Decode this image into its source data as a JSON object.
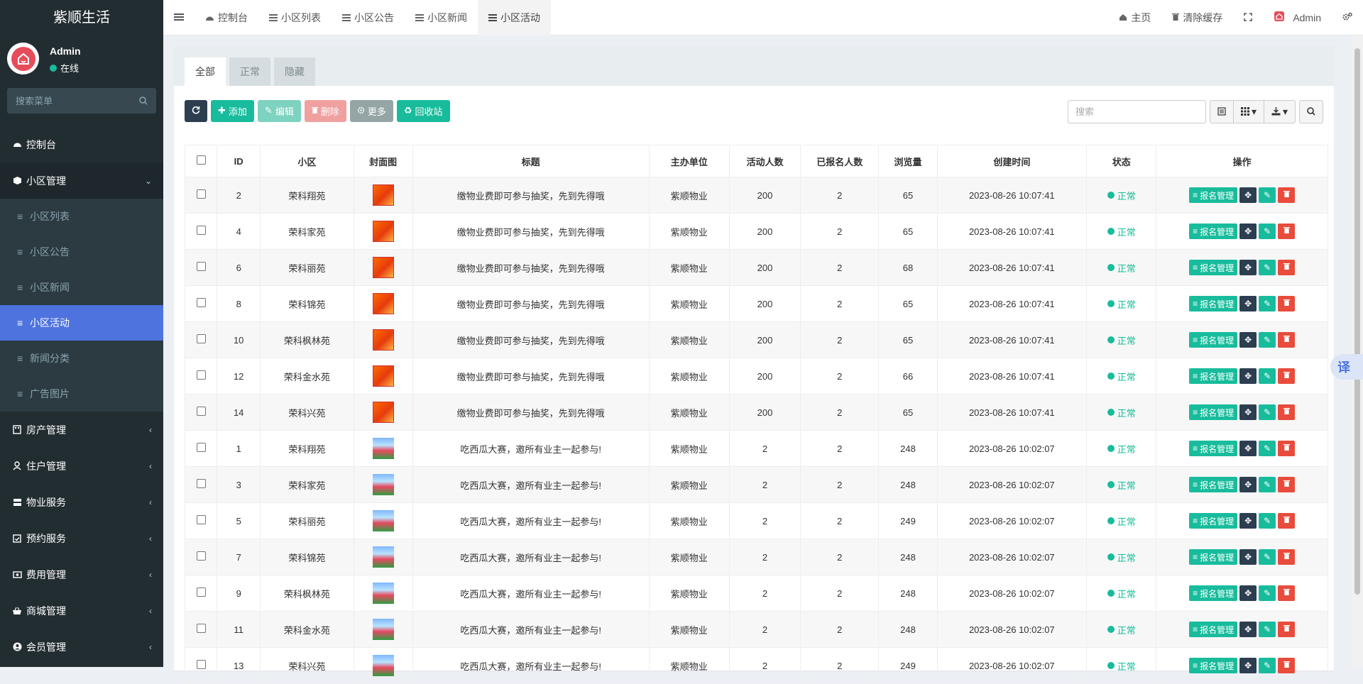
{
  "app_title": "紫顺生活",
  "user": {
    "name": "Admin",
    "status": "在线"
  },
  "sidebar": {
    "search_placeholder": "搜索菜单",
    "items": [
      {
        "label": "控制台"
      },
      {
        "label": "小区管理"
      },
      {
        "label": "房产管理"
      },
      {
        "label": "住户管理"
      },
      {
        "label": "物业服务"
      },
      {
        "label": "预约服务"
      },
      {
        "label": "费用管理"
      },
      {
        "label": "商城管理"
      },
      {
        "label": "会员管理"
      }
    ],
    "sub_items": [
      {
        "label": "小区列表"
      },
      {
        "label": "小区公告"
      },
      {
        "label": "小区新闻"
      },
      {
        "label": "小区活动"
      },
      {
        "label": "新闻分类"
      },
      {
        "label": "广告图片"
      }
    ]
  },
  "topbar": {
    "tabs": [
      "控制台",
      "小区列表",
      "小区公告",
      "小区新闻",
      "小区活动"
    ],
    "right": {
      "home": "主页",
      "clear_cache": "清除缓存",
      "user": "Admin"
    }
  },
  "panel_tabs": [
    "全部",
    "正常",
    "隐藏"
  ],
  "toolbar": {
    "add": "添加",
    "edit": "编辑",
    "delete": "删除",
    "more": "更多",
    "recycle": "回收站",
    "search_placeholder": "搜索"
  },
  "table": {
    "headers": [
      "ID",
      "小区",
      "封面图",
      "标题",
      "主办单位",
      "活动人数",
      "已报名人数",
      "浏览量",
      "创建时间",
      "状态",
      "操作"
    ],
    "op_label": "报名管理",
    "rows": [
      {
        "id": "2",
        "community": "荣科翔苑",
        "img": "a",
        "title": "缴物业费即可参与抽奖，先到先得哦",
        "org": "紫顺物业",
        "capacity": "200",
        "signed": "2",
        "views": "65",
        "created": "2023-08-26 10:07:41",
        "status": "正常"
      },
      {
        "id": "4",
        "community": "荣科家苑",
        "img": "a",
        "title": "缴物业费即可参与抽奖，先到先得哦",
        "org": "紫顺物业",
        "capacity": "200",
        "signed": "2",
        "views": "65",
        "created": "2023-08-26 10:07:41",
        "status": "正常"
      },
      {
        "id": "6",
        "community": "荣科丽苑",
        "img": "a",
        "title": "缴物业费即可参与抽奖，先到先得哦",
        "org": "紫顺物业",
        "capacity": "200",
        "signed": "2",
        "views": "68",
        "created": "2023-08-26 10:07:41",
        "status": "正常"
      },
      {
        "id": "8",
        "community": "荣科锦苑",
        "img": "a",
        "title": "缴物业费即可参与抽奖，先到先得哦",
        "org": "紫顺物业",
        "capacity": "200",
        "signed": "2",
        "views": "65",
        "created": "2023-08-26 10:07:41",
        "status": "正常"
      },
      {
        "id": "10",
        "community": "荣科枫林苑",
        "img": "a",
        "title": "缴物业费即可参与抽奖，先到先得哦",
        "org": "紫顺物业",
        "capacity": "200",
        "signed": "2",
        "views": "65",
        "created": "2023-08-26 10:07:41",
        "status": "正常"
      },
      {
        "id": "12",
        "community": "荣科金水苑",
        "img": "a",
        "title": "缴物业费即可参与抽奖，先到先得哦",
        "org": "紫顺物业",
        "capacity": "200",
        "signed": "2",
        "views": "66",
        "created": "2023-08-26 10:07:41",
        "status": "正常"
      },
      {
        "id": "14",
        "community": "荣科兴苑",
        "img": "a",
        "title": "缴物业费即可参与抽奖，先到先得哦",
        "org": "紫顺物业",
        "capacity": "200",
        "signed": "2",
        "views": "65",
        "created": "2023-08-26 10:07:41",
        "status": "正常"
      },
      {
        "id": "1",
        "community": "荣科翔苑",
        "img": "b",
        "title": "吃西瓜大赛，邀所有业主一起参与!",
        "org": "紫顺物业",
        "capacity": "2",
        "signed": "2",
        "views": "248",
        "created": "2023-08-26 10:02:07",
        "status": "正常"
      },
      {
        "id": "3",
        "community": "荣科家苑",
        "img": "b",
        "title": "吃西瓜大赛，邀所有业主一起参与!",
        "org": "紫顺物业",
        "capacity": "2",
        "signed": "2",
        "views": "248",
        "created": "2023-08-26 10:02:07",
        "status": "正常"
      },
      {
        "id": "5",
        "community": "荣科丽苑",
        "img": "b",
        "title": "吃西瓜大赛，邀所有业主一起参与!",
        "org": "紫顺物业",
        "capacity": "2",
        "signed": "2",
        "views": "249",
        "created": "2023-08-26 10:02:07",
        "status": "正常"
      },
      {
        "id": "7",
        "community": "荣科锦苑",
        "img": "b",
        "title": "吃西瓜大赛，邀所有业主一起参与!",
        "org": "紫顺物业",
        "capacity": "2",
        "signed": "2",
        "views": "248",
        "created": "2023-08-26 10:02:07",
        "status": "正常"
      },
      {
        "id": "9",
        "community": "荣科枫林苑",
        "img": "b",
        "title": "吃西瓜大赛，邀所有业主一起参与!",
        "org": "紫顺物业",
        "capacity": "2",
        "signed": "2",
        "views": "248",
        "created": "2023-08-26 10:02:07",
        "status": "正常"
      },
      {
        "id": "11",
        "community": "荣科金水苑",
        "img": "b",
        "title": "吃西瓜大赛，邀所有业主一起参与!",
        "org": "紫顺物业",
        "capacity": "2",
        "signed": "2",
        "views": "248",
        "created": "2023-08-26 10:02:07",
        "status": "正常"
      },
      {
        "id": "13",
        "community": "荣科兴苑",
        "img": "b",
        "title": "吃西瓜大赛，邀所有业主一起参与!",
        "org": "紫顺物业",
        "capacity": "2",
        "signed": "2",
        "views": "249",
        "created": "2023-08-26 10:02:07",
        "status": "正常"
      }
    ]
  },
  "translate_label": "译",
  "colors": {
    "sidebar_bg": "#222d32",
    "accent_active": "#4e73df",
    "success": "#18bc9c",
    "danger": "#e74c3c",
    "dark_button": "#2c3e50"
  }
}
